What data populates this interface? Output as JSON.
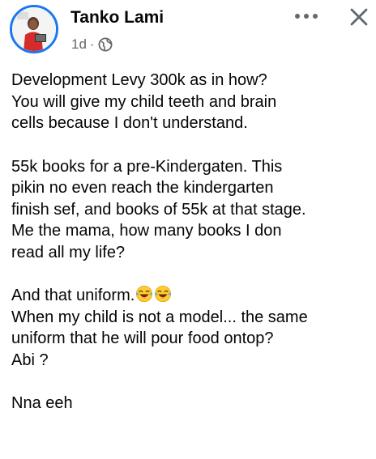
{
  "post": {
    "author": "Tanko Lami",
    "time": "1d",
    "separator": "·",
    "privacy_icon": "globe-icon",
    "menu_icon": "more-icon",
    "close_icon": "close-icon",
    "paragraphs": [
      [
        "Development Levy 300k as in how?",
        "You will give my child teeth and brain",
        "cells because I don't understand."
      ],
      [
        "55k books for a pre-Kindergaten. This",
        "pikin no even reach the kindergarten",
        "finish sef, and books of 55k at that stage.",
        "Me the mama, how many books I don",
        "read all my life?"
      ],
      [
        "And that uniform.",
        "When my child is not a model... the same",
        "uniform that he will pour food ontop?",
        "Abi ?"
      ],
      [
        "Nna eeh"
      ]
    ],
    "emoji": "laughing-crying-emoji"
  },
  "colors": {
    "text": "#050505",
    "meta": "#65676b",
    "avatar_ring": "#1877f2"
  }
}
